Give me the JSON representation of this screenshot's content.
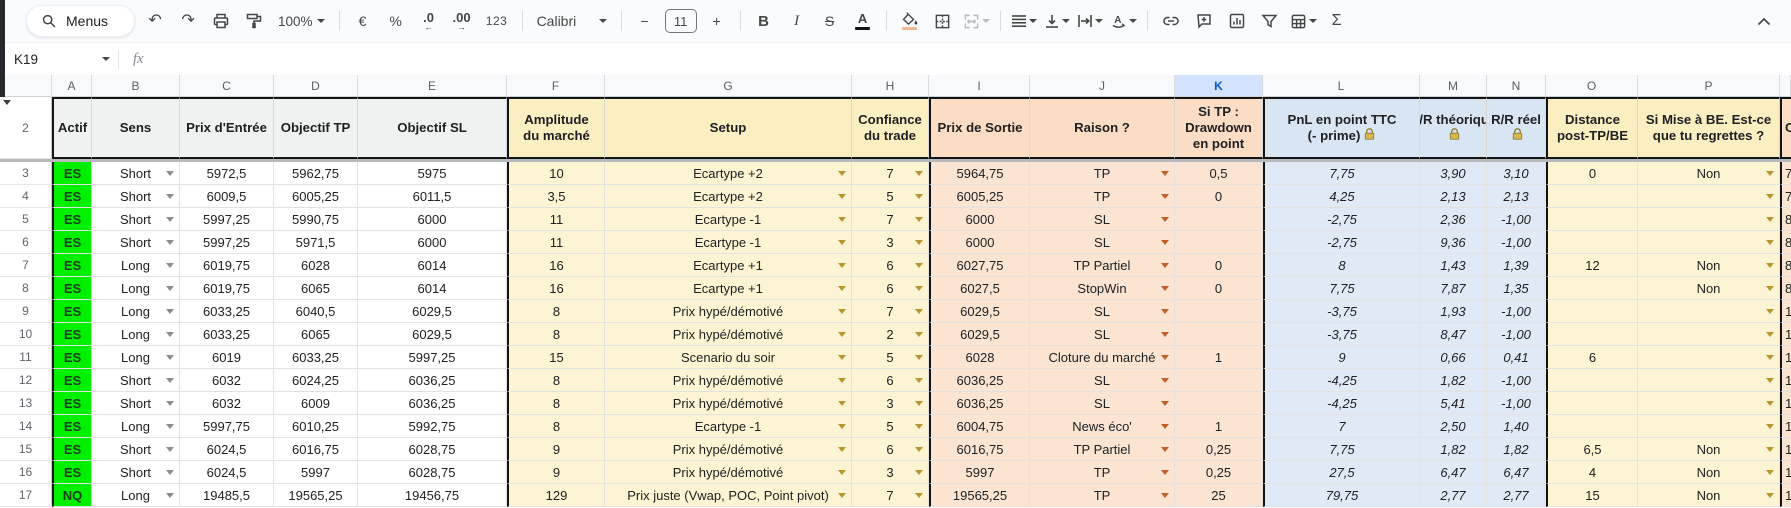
{
  "toolbar": {
    "menus": "Menus",
    "zoom": "100%",
    "euro": "€",
    "percent": "%",
    "dec0": ".0",
    "dec00": ".00",
    "dec0_arrow": "←",
    "dec00_arrow": "→",
    "fmt": "123",
    "font": "Calibri",
    "size": "11",
    "minus": "−",
    "plus": "+",
    "bold": "B",
    "italic": "I",
    "strike": "S",
    "color": "A",
    "sum": "Σ"
  },
  "formula_bar": {
    "name_box": "K19",
    "fx": "fx"
  },
  "icons": [
    "search-icon",
    "undo-icon",
    "redo-icon",
    "print-icon",
    "paint-format-icon",
    "fill-color-icon",
    "borders-icon",
    "merge-cells-icon",
    "align-icon",
    "vertical-align-icon",
    "text-wrap-icon",
    "text-rotation-icon",
    "link-icon",
    "comment-icon",
    "chart-icon",
    "filter-icon",
    "table-icon",
    "functions-icon",
    "collapse-toolbar-icon",
    "lock-icon",
    "dropdown-icon",
    "group-collapse-icon"
  ],
  "colors": {
    "selected_header_bg": "#d3e3fd",
    "selected_header_text": "#0b57d0",
    "actif_green": "#00f000",
    "yellow_section": "#fdf4d4",
    "peach_section": "#fbe4d2",
    "blue_section": "#dfeaf6",
    "fill_swatch": "#f0b795"
  },
  "sheet": {
    "header_row_number": "2",
    "columns": [
      {
        "letter": "A",
        "type": "actif",
        "group": "gray",
        "thick": true
      },
      {
        "letter": "B",
        "type": "dd-gray",
        "group": "gray",
        "dd": "gray"
      },
      {
        "letter": "C",
        "type": "num",
        "group": "gray"
      },
      {
        "letter": "D",
        "type": "num",
        "group": "gray"
      },
      {
        "letter": "E",
        "type": "num",
        "group": "gray"
      },
      {
        "letter": "F",
        "type": "num-yellow",
        "group": "yellow",
        "thick": true
      },
      {
        "letter": "G",
        "type": "dd-gold",
        "group": "yellow",
        "dd": "gold"
      },
      {
        "letter": "H",
        "type": "dd-gold",
        "group": "yellow",
        "dd": "gold"
      },
      {
        "letter": "I",
        "type": "num-peach",
        "group": "peach",
        "thick": true
      },
      {
        "letter": "J",
        "type": "dd-orange",
        "group": "peach",
        "dd": "orange"
      },
      {
        "letter": "K",
        "type": "num-peach",
        "group": "peach",
        "selected": true
      },
      {
        "letter": "L",
        "type": "num-blue",
        "group": "blue",
        "thick": true
      },
      {
        "letter": "M",
        "type": "num-blue",
        "group": "blue"
      },
      {
        "letter": "N",
        "type": "num-blue",
        "group": "blue"
      },
      {
        "letter": "O",
        "type": "num-yellow",
        "group": "yellow",
        "thick": true
      },
      {
        "letter": "P",
        "type": "dd-gold",
        "group": "yellow",
        "dd": "gold"
      },
      {
        "letter": "",
        "type": "clip-peach",
        "group": "peach",
        "thick": true
      }
    ],
    "header_cells": [
      {
        "lines": [
          "Actif"
        ]
      },
      {
        "lines": [
          "Sens"
        ]
      },
      {
        "lines": [
          "Prix d'Entrée"
        ]
      },
      {
        "lines": [
          "Objectif TP"
        ]
      },
      {
        "lines": [
          "Objectif SL"
        ]
      },
      {
        "lines": [
          "Amplitude",
          "du marché"
        ]
      },
      {
        "lines": [
          "Setup"
        ]
      },
      {
        "lines": [
          "Confiance",
          "du trade"
        ]
      },
      {
        "lines": [
          "Prix de Sortie"
        ]
      },
      {
        "lines": [
          "Raison ?"
        ]
      },
      {
        "lines": [
          "Si TP :",
          "Drawdown",
          "en point"
        ]
      },
      {
        "lines": [
          "PnL en point TTC",
          "(- prime)"
        ],
        "lock": "inline"
      },
      {
        "lines": [
          "R/R théorique"
        ],
        "lock": "own"
      },
      {
        "lines": [
          "R/R réel"
        ],
        "lock": "own"
      },
      {
        "lines": [
          "Distance",
          "post-TP/BE"
        ]
      },
      {
        "lines": [
          "Si Mise à BE. Est-ce",
          "que tu regrettes ?"
        ]
      },
      {
        "lines": [
          "C"
        ]
      }
    ],
    "rows": [
      {
        "n": "3",
        "c": [
          "ES",
          "Short",
          "5972,5",
          "5962,75",
          "5975",
          "10",
          "Ecartype +2",
          "7",
          "5964,75",
          "TP",
          "0,5",
          "7,75",
          "3,90",
          "3,10",
          "0",
          "Non",
          "7"
        ]
      },
      {
        "n": "4",
        "c": [
          "ES",
          "Short",
          "6009,5",
          "6005,25",
          "6011,5",
          "3,5",
          "Ecartype +2",
          "5",
          "6005,25",
          "TP",
          "0",
          "4,25",
          "2,13",
          "2,13",
          "",
          "",
          "7"
        ]
      },
      {
        "n": "5",
        "c": [
          "ES",
          "Short",
          "5997,25",
          "5990,75",
          "6000",
          "11",
          "Ecartype -1",
          "7",
          "6000",
          "SL",
          "",
          "-2,75",
          "2,36",
          "-1,00",
          "",
          "",
          "8"
        ]
      },
      {
        "n": "6",
        "c": [
          "ES",
          "Short",
          "5997,25",
          "5971,5",
          "6000",
          "11",
          "Ecartype -1",
          "3",
          "6000",
          "SL",
          "",
          "-2,75",
          "9,36",
          "-1,00",
          "",
          "",
          "8"
        ]
      },
      {
        "n": "7",
        "c": [
          "ES",
          "Long",
          "6019,75",
          "6028",
          "6014",
          "16",
          "Ecartype +1",
          "6",
          "6027,75",
          "TP Partiel",
          "0",
          "8",
          "1,43",
          "1,39",
          "12",
          "Non",
          "8"
        ]
      },
      {
        "n": "8",
        "c": [
          "ES",
          "Long",
          "6019,75",
          "6065",
          "6014",
          "16",
          "Ecartype +1",
          "6",
          "6027,5",
          "StopWin",
          "0",
          "7,75",
          "7,87",
          "1,35",
          "",
          "Non",
          "8"
        ]
      },
      {
        "n": "9",
        "c": [
          "ES",
          "Long",
          "6033,25",
          "6040,5",
          "6029,5",
          "8",
          "Prix hypé/démotivé",
          "7",
          "6029,5",
          "SL",
          "",
          "-3,75",
          "1,93",
          "-1,00",
          "",
          "",
          "1"
        ]
      },
      {
        "n": "10",
        "c": [
          "ES",
          "Long",
          "6033,25",
          "6065",
          "6029,5",
          "8",
          "Prix hypé/démotivé",
          "2",
          "6029,5",
          "SL",
          "",
          "-3,75",
          "8,47",
          "-1,00",
          "",
          "",
          "1"
        ]
      },
      {
        "n": "11",
        "c": [
          "ES",
          "Long",
          "6019",
          "6033,25",
          "5997,25",
          "15",
          "Scenario du soir",
          "5",
          "6028",
          "Cloture du marché",
          "1",
          "9",
          "0,66",
          "0,41",
          "6",
          "",
          "1"
        ]
      },
      {
        "n": "12",
        "c": [
          "ES",
          "Short",
          "6032",
          "6024,25",
          "6036,25",
          "8",
          "Prix hypé/démotivé",
          "6",
          "6036,25",
          "SL",
          "",
          "-4,25",
          "1,82",
          "-1,00",
          "",
          "",
          "1"
        ]
      },
      {
        "n": "13",
        "c": [
          "ES",
          "Short",
          "6032",
          "6009",
          "6036,25",
          "8",
          "Prix hypé/démotivé",
          "3",
          "6036,25",
          "SL",
          "",
          "-4,25",
          "5,41",
          "-1,00",
          "",
          "",
          "1"
        ]
      },
      {
        "n": "14",
        "c": [
          "ES",
          "Long",
          "5997,75",
          "6010,25",
          "5992,75",
          "8",
          "Ecartype -1",
          "5",
          "6004,75",
          "News éco'",
          "1",
          "7",
          "2,50",
          "1,40",
          "",
          "",
          "1"
        ]
      },
      {
        "n": "15",
        "c": [
          "ES",
          "Short",
          "6024,5",
          "6016,75",
          "6028,75",
          "9",
          "Prix hypé/démotivé",
          "6",
          "6016,75",
          "TP Partiel",
          "0,25",
          "7,75",
          "1,82",
          "1,82",
          "6,5",
          "Non",
          "1"
        ]
      },
      {
        "n": "16",
        "c": [
          "ES",
          "Short",
          "6024,5",
          "5997",
          "6028,75",
          "9",
          "Prix hypé/démotivé",
          "3",
          "5997",
          "TP",
          "0,25",
          "27,5",
          "6,47",
          "6,47",
          "4",
          "Non",
          "1"
        ]
      },
      {
        "n": "17",
        "c": [
          "NQ",
          "Long",
          "19485,5",
          "19565,25",
          "19456,75",
          "129",
          "Prix juste (Vwap, POC, Point pivot)",
          "7",
          "19565,25",
          "TP",
          "25",
          "79,75",
          "2,77",
          "2,77",
          "15",
          "Non",
          "1"
        ]
      }
    ]
  }
}
